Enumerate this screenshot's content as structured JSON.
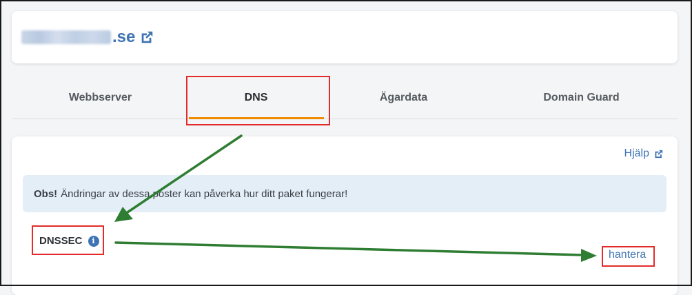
{
  "header": {
    "domain_suffix": ".se",
    "external_icon": "external-link-icon"
  },
  "tabs": [
    {
      "label": "Webbserver",
      "active": false
    },
    {
      "label": "DNS",
      "active": true
    },
    {
      "label": "Ägardata",
      "active": false
    },
    {
      "label": "Domain Guard",
      "active": false
    }
  ],
  "dns": {
    "help_label": "Hjälp",
    "notice_bold": "Obs!",
    "notice_text": "Ändringar av dessa poster kan påverka hur ditt paket fungerar!",
    "dnssec_label": "DNSSEC",
    "info_icon_glyph": "i",
    "manage_label": "hantera"
  },
  "colors": {
    "accent": "#3f74b4",
    "tab_underline": "#f08a00",
    "highlight": "#e32b2b",
    "annotation_arrow": "#2e7d32",
    "notice_bg": "#e4eef7"
  }
}
